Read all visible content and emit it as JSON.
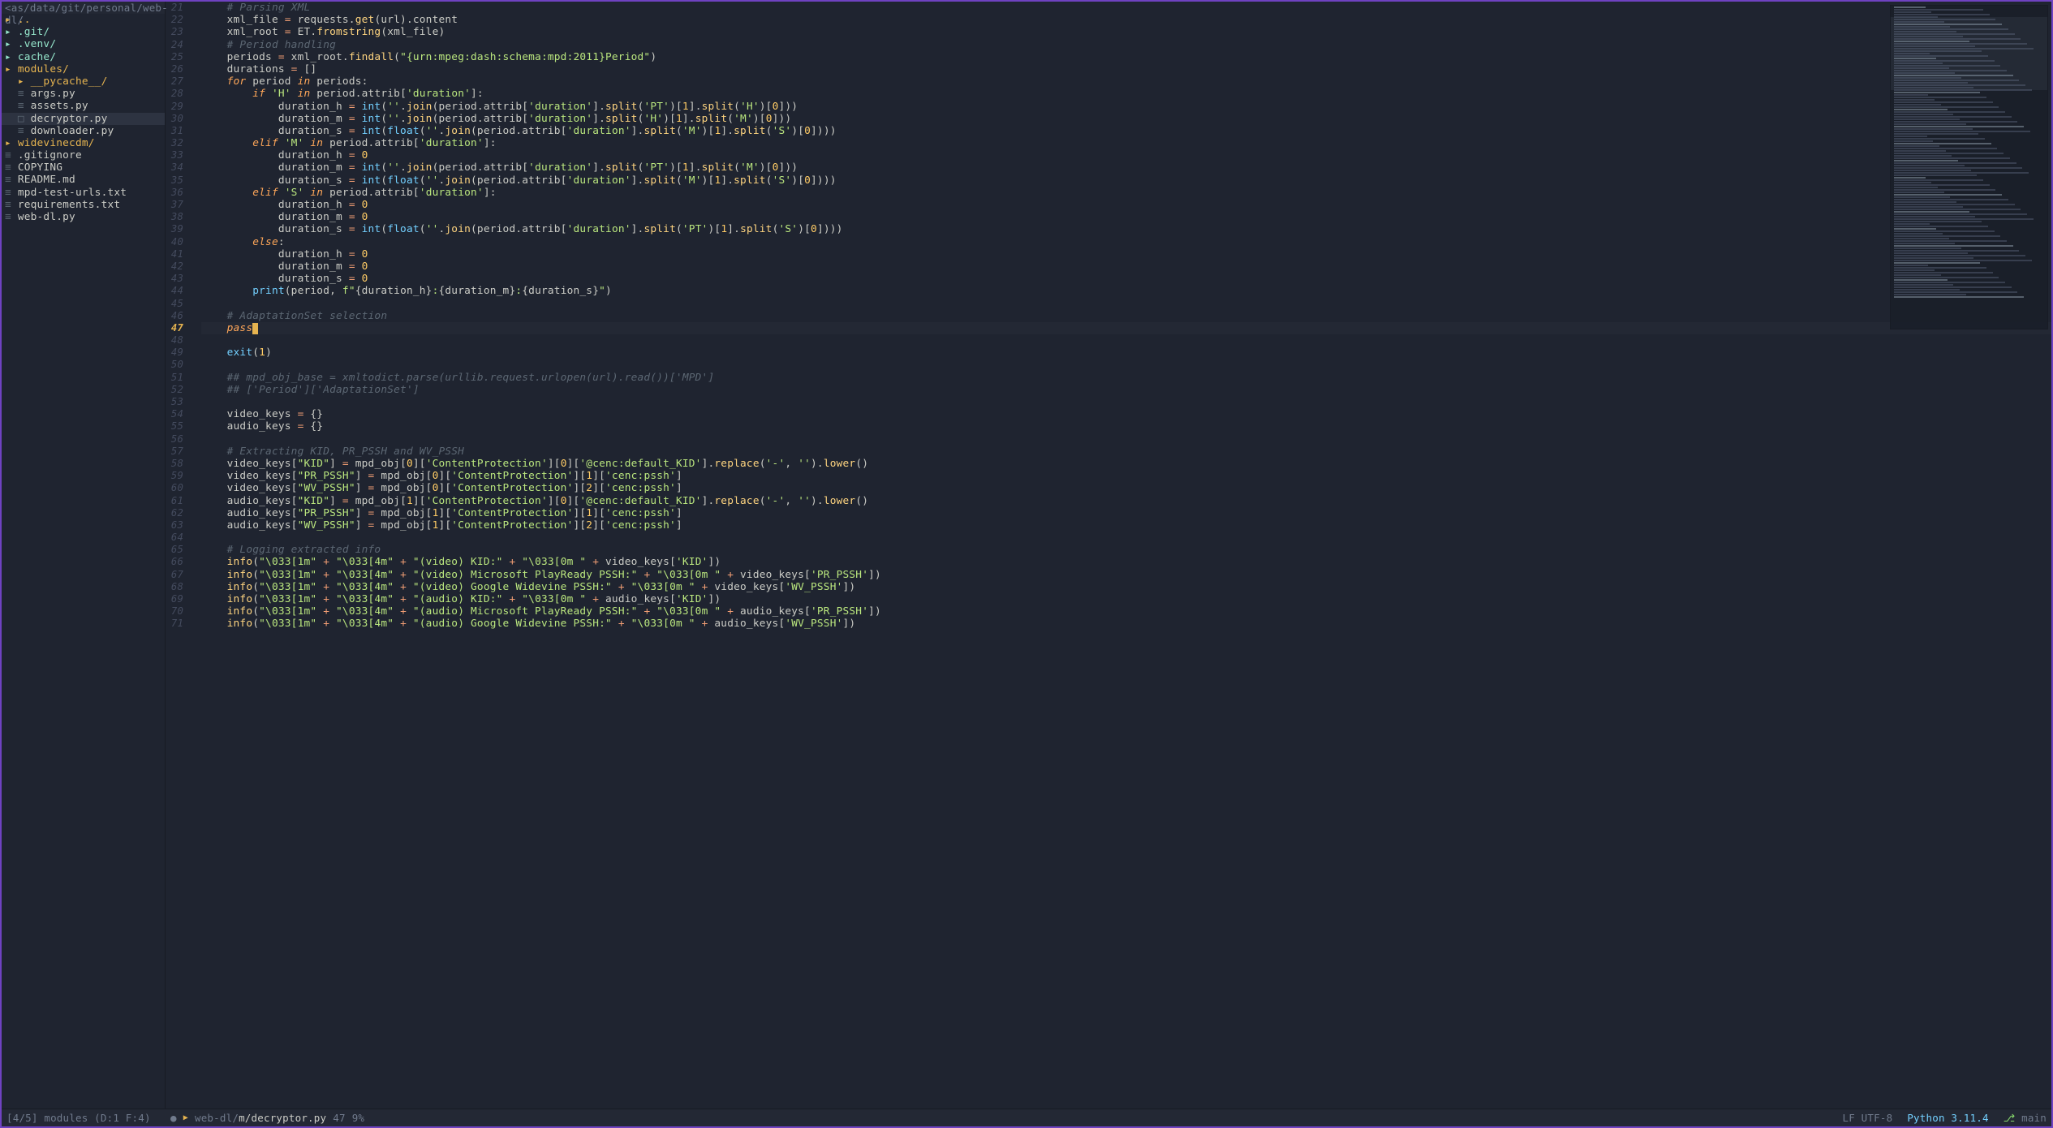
{
  "tree": {
    "header": "<as/data/git/personal/web-dl/",
    "items": [
      {
        "indent": 0,
        "icon": "folder",
        "name": "..",
        "style": "folder"
      },
      {
        "indent": 0,
        "icon": "folderg",
        "name": ".git/",
        "style": "folderg"
      },
      {
        "indent": 0,
        "icon": "folderg",
        "name": ".venv/",
        "style": "folderg"
      },
      {
        "indent": 0,
        "icon": "folderg",
        "name": "cache/",
        "style": "folderg"
      },
      {
        "indent": 0,
        "icon": "folder",
        "name": "modules/",
        "style": "folder"
      },
      {
        "indent": 1,
        "icon": "folder",
        "name": "__pycache__/",
        "style": "folder"
      },
      {
        "indent": 1,
        "icon": "file",
        "name": "args.py",
        "style": "name"
      },
      {
        "indent": 1,
        "icon": "file",
        "name": "assets.py",
        "style": "name"
      },
      {
        "indent": 1,
        "icon": "file-open",
        "name": "decryptor.py",
        "style": "name",
        "selected": true
      },
      {
        "indent": 1,
        "icon": "file",
        "name": "downloader.py",
        "style": "name"
      },
      {
        "indent": 0,
        "icon": "folder",
        "name": "widevinecdm/",
        "style": "folder"
      },
      {
        "indent": 0,
        "icon": "file",
        "name": ".gitignore",
        "style": "name"
      },
      {
        "indent": 0,
        "icon": "file",
        "name": "COPYING",
        "style": "name"
      },
      {
        "indent": 0,
        "icon": "file",
        "name": "README.md",
        "style": "name"
      },
      {
        "indent": 0,
        "icon": "file",
        "name": "mpd-test-urls.txt",
        "style": "name"
      },
      {
        "indent": 0,
        "icon": "file",
        "name": "requirements.txt",
        "style": "name"
      },
      {
        "indent": 0,
        "icon": "file",
        "name": "web-dl.py",
        "style": "name"
      }
    ]
  },
  "editor": {
    "first_line": 21,
    "current_line": 47,
    "lines": [
      {
        "n": 21,
        "html": "    <span class='c-cmt'># Parsing XML</span>"
      },
      {
        "n": 22,
        "html": "    xml_file <span class='c-op'>=</span> requests.<span class='c-fn'>get</span>(url).content"
      },
      {
        "n": 23,
        "html": "    xml_root <span class='c-op'>=</span> ET.<span class='c-fn'>fromstring</span>(xml_file)"
      },
      {
        "n": 24,
        "html": "    <span class='c-cmt'># Period handling</span>"
      },
      {
        "n": 25,
        "html": "    periods <span class='c-op'>=</span> xml_root.<span class='c-fn'>findall</span>(<span class='c-str'>\"{urn:mpeg:dash:schema:mpd:2011}Period\"</span>)"
      },
      {
        "n": 26,
        "html": "    durations <span class='c-op'>=</span> []"
      },
      {
        "n": 27,
        "html": "    <span class='c-kw'>for</span> period <span class='c-kw'>in</span> periods:"
      },
      {
        "n": 28,
        "html": "        <span class='c-kw'>if</span> <span class='c-str'>'H'</span> <span class='c-kw'>in</span> period.attrib[<span class='c-str'>'duration'</span>]:"
      },
      {
        "n": 29,
        "html": "            duration_h <span class='c-op'>=</span> <span class='c-builtin'>int</span>(<span class='c-str'>''</span>.<span class='c-fn'>join</span>(period.attrib[<span class='c-str'>'duration'</span>].<span class='c-fn'>split</span>(<span class='c-str'>'PT'</span>)[<span class='c-num'>1</span>].<span class='c-fn'>split</span>(<span class='c-str'>'H'</span>)[<span class='c-num'>0</span>]))"
      },
      {
        "n": 30,
        "html": "            duration_m <span class='c-op'>=</span> <span class='c-builtin'>int</span>(<span class='c-str'>''</span>.<span class='c-fn'>join</span>(period.attrib[<span class='c-str'>'duration'</span>].<span class='c-fn'>split</span>(<span class='c-str'>'H'</span>)[<span class='c-num'>1</span>].<span class='c-fn'>split</span>(<span class='c-str'>'M'</span>)[<span class='c-num'>0</span>]))"
      },
      {
        "n": 31,
        "html": "            duration_s <span class='c-op'>=</span> <span class='c-builtin'>int</span>(<span class='c-builtin'>float</span>(<span class='c-str'>''</span>.<span class='c-fn'>join</span>(period.attrib[<span class='c-str'>'duration'</span>].<span class='c-fn'>split</span>(<span class='c-str'>'M'</span>)[<span class='c-num'>1</span>].<span class='c-fn'>split</span>(<span class='c-str'>'S'</span>)[<span class='c-num'>0</span>])))"
      },
      {
        "n": 32,
        "html": "        <span class='c-kw'>elif</span> <span class='c-str'>'M'</span> <span class='c-kw'>in</span> period.attrib[<span class='c-str'>'duration'</span>]:"
      },
      {
        "n": 33,
        "html": "            duration_h <span class='c-op'>=</span> <span class='c-num'>0</span>"
      },
      {
        "n": 34,
        "html": "            duration_m <span class='c-op'>=</span> <span class='c-builtin'>int</span>(<span class='c-str'>''</span>.<span class='c-fn'>join</span>(period.attrib[<span class='c-str'>'duration'</span>].<span class='c-fn'>split</span>(<span class='c-str'>'PT'</span>)[<span class='c-num'>1</span>].<span class='c-fn'>split</span>(<span class='c-str'>'M'</span>)[<span class='c-num'>0</span>]))"
      },
      {
        "n": 35,
        "html": "            duration_s <span class='c-op'>=</span> <span class='c-builtin'>int</span>(<span class='c-builtin'>float</span>(<span class='c-str'>''</span>.<span class='c-fn'>join</span>(period.attrib[<span class='c-str'>'duration'</span>].<span class='c-fn'>split</span>(<span class='c-str'>'M'</span>)[<span class='c-num'>1</span>].<span class='c-fn'>split</span>(<span class='c-str'>'S'</span>)[<span class='c-num'>0</span>])))"
      },
      {
        "n": 36,
        "html": "        <span class='c-kw'>elif</span> <span class='c-str'>'S'</span> <span class='c-kw'>in</span> period.attrib[<span class='c-str'>'duration'</span>]:"
      },
      {
        "n": 37,
        "html": "            duration_h <span class='c-op'>=</span> <span class='c-num'>0</span>"
      },
      {
        "n": 38,
        "html": "            duration_m <span class='c-op'>=</span> <span class='c-num'>0</span>"
      },
      {
        "n": 39,
        "html": "            duration_s <span class='c-op'>=</span> <span class='c-builtin'>int</span>(<span class='c-builtin'>float</span>(<span class='c-str'>''</span>.<span class='c-fn'>join</span>(period.attrib[<span class='c-str'>'duration'</span>].<span class='c-fn'>split</span>(<span class='c-str'>'PT'</span>)[<span class='c-num'>1</span>].<span class='c-fn'>split</span>(<span class='c-str'>'S'</span>)[<span class='c-num'>0</span>])))"
      },
      {
        "n": 40,
        "html": "        <span class='c-kw'>else</span>:"
      },
      {
        "n": 41,
        "html": "            duration_h <span class='c-op'>=</span> <span class='c-num'>0</span>"
      },
      {
        "n": 42,
        "html": "            duration_m <span class='c-op'>=</span> <span class='c-num'>0</span>"
      },
      {
        "n": 43,
        "html": "            duration_s <span class='c-op'>=</span> <span class='c-num'>0</span>"
      },
      {
        "n": 44,
        "html": "        <span class='c-builtin'>print</span>(period, <span class='c-str'>f\"</span>{duration_h}<span class='c-str'>:</span>{duration_m}<span class='c-str'>:</span>{duration_s}<span class='c-str'>\"</span>)"
      },
      {
        "n": 45,
        "html": ""
      },
      {
        "n": 46,
        "html": "    <span class='c-cmt'># AdaptationSet selection</span>"
      },
      {
        "n": 47,
        "html": "    <span class='c-kw'>pass</span><span class='cursor-block'></span>",
        "current": true
      },
      {
        "n": 48,
        "html": ""
      },
      {
        "n": 49,
        "html": "    <span class='c-builtin'>exit</span>(<span class='c-num'>1</span>)"
      },
      {
        "n": 50,
        "html": ""
      },
      {
        "n": 51,
        "html": "    <span class='c-cmt'>## mpd_obj_base = xmltodict.parse(urllib.request.urlopen(url).read())['MPD']</span>"
      },
      {
        "n": 52,
        "html": "    <span class='c-cmt'>## ['Period']['AdaptationSet']</span>"
      },
      {
        "n": 53,
        "html": ""
      },
      {
        "n": 54,
        "html": "    video_keys <span class='c-op'>=</span> {}"
      },
      {
        "n": 55,
        "html": "    audio_keys <span class='c-op'>=</span> {}"
      },
      {
        "n": 56,
        "html": ""
      },
      {
        "n": 57,
        "html": "    <span class='c-cmt'># Extracting KID, PR_PSSH and WV_PSSH</span>"
      },
      {
        "n": 58,
        "html": "    video_keys[<span class='c-str'>\"KID\"</span>] <span class='c-op'>=</span> mpd_obj[<span class='c-num'>0</span>][<span class='c-str'>'ContentProtection'</span>][<span class='c-num'>0</span>][<span class='c-str'>'@cenc:default_KID'</span>].<span class='c-fn'>replace</span>(<span class='c-str'>'-'</span>, <span class='c-str'>''</span>).<span class='c-fn'>lower</span>()"
      },
      {
        "n": 59,
        "html": "    video_keys[<span class='c-str'>\"PR_PSSH\"</span>] <span class='c-op'>=</span> mpd_obj[<span class='c-num'>0</span>][<span class='c-str'>'ContentProtection'</span>][<span class='c-num'>1</span>][<span class='c-str'>'cenc:pssh'</span>]"
      },
      {
        "n": 60,
        "html": "    video_keys[<span class='c-str'>\"WV_PSSH\"</span>] <span class='c-op'>=</span> mpd_obj[<span class='c-num'>0</span>][<span class='c-str'>'ContentProtection'</span>][<span class='c-num'>2</span>][<span class='c-str'>'cenc:pssh'</span>]"
      },
      {
        "n": 61,
        "html": "    audio_keys[<span class='c-str'>\"KID\"</span>] <span class='c-op'>=</span> mpd_obj[<span class='c-num'>1</span>][<span class='c-str'>'ContentProtection'</span>][<span class='c-num'>0</span>][<span class='c-str'>'@cenc:default_KID'</span>].<span class='c-fn'>replace</span>(<span class='c-str'>'-'</span>, <span class='c-str'>''</span>).<span class='c-fn'>lower</span>()"
      },
      {
        "n": 62,
        "html": "    audio_keys[<span class='c-str'>\"PR_PSSH\"</span>] <span class='c-op'>=</span> mpd_obj[<span class='c-num'>1</span>][<span class='c-str'>'ContentProtection'</span>][<span class='c-num'>1</span>][<span class='c-str'>'cenc:pssh'</span>]"
      },
      {
        "n": 63,
        "html": "    audio_keys[<span class='c-str'>\"WV_PSSH\"</span>] <span class='c-op'>=</span> mpd_obj[<span class='c-num'>1</span>][<span class='c-str'>'ContentProtection'</span>][<span class='c-num'>2</span>][<span class='c-str'>'cenc:pssh'</span>]"
      },
      {
        "n": 64,
        "html": ""
      },
      {
        "n": 65,
        "html": "    <span class='c-cmt'># Logging extracted info</span>"
      },
      {
        "n": 66,
        "html": "    <span class='c-fn'>info</span>(<span class='c-str'>\"\\033[1m\"</span> <span class='c-op'>+</span> <span class='c-str'>\"\\033[4m\"</span> <span class='c-op'>+</span> <span class='c-str'>\"(video) KID:\"</span> <span class='c-op'>+</span> <span class='c-str'>\"\\033[0m \"</span> <span class='c-op'>+</span> video_keys[<span class='c-str'>'KID'</span>])"
      },
      {
        "n": 67,
        "html": "    <span class='c-fn'>info</span>(<span class='c-str'>\"\\033[1m\"</span> <span class='c-op'>+</span> <span class='c-str'>\"\\033[4m\"</span> <span class='c-op'>+</span> <span class='c-str'>\"(video) Microsoft PlayReady PSSH:\"</span> <span class='c-op'>+</span> <span class='c-str'>\"\\033[0m \"</span> <span class='c-op'>+</span> video_keys[<span class='c-str'>'PR_PSSH'</span>])"
      },
      {
        "n": 68,
        "html": "    <span class='c-fn'>info</span>(<span class='c-str'>\"\\033[1m\"</span> <span class='c-op'>+</span> <span class='c-str'>\"\\033[4m\"</span> <span class='c-op'>+</span> <span class='c-str'>\"(video) Google Widevine PSSH:\"</span> <span class='c-op'>+</span> <span class='c-str'>\"\\033[0m \"</span> <span class='c-op'>+</span> video_keys[<span class='c-str'>'WV_PSSH'</span>])"
      },
      {
        "n": 69,
        "html": "    <span class='c-fn'>info</span>(<span class='c-str'>\"\\033[1m\"</span> <span class='c-op'>+</span> <span class='c-str'>\"\\033[4m\"</span> <span class='c-op'>+</span> <span class='c-str'>\"(audio) KID:\"</span> <span class='c-op'>+</span> <span class='c-str'>\"\\033[0m \"</span> <span class='c-op'>+</span> audio_keys[<span class='c-str'>'KID'</span>])"
      },
      {
        "n": 70,
        "html": "    <span class='c-fn'>info</span>(<span class='c-str'>\"\\033[1m\"</span> <span class='c-op'>+</span> <span class='c-str'>\"\\033[4m\"</span> <span class='c-op'>+</span> <span class='c-str'>\"(audio) Microsoft PlayReady PSSH:\"</span> <span class='c-op'>+</span> <span class='c-str'>\"\\033[0m \"</span> <span class='c-op'>+</span> audio_keys[<span class='c-str'>'PR_PSSH'</span>])"
      },
      {
        "n": 71,
        "html": "    <span class='c-fn'>info</span>(<span class='c-str'>\"\\033[1m\"</span> <span class='c-op'>+</span> <span class='c-str'>\"\\033[4m\"</span> <span class='c-op'>+</span> <span class='c-str'>\"(audio) Google Widevine PSSH:\"</span> <span class='c-op'>+</span> <span class='c-str'>\"\\033[0m \"</span> <span class='c-op'>+</span> audio_keys[<span class='c-str'>'WV_PSSH'</span>])"
      }
    ]
  },
  "statusbar": {
    "left": "[4/5] modules (D:1 F:4)",
    "path_dim1": "web-dl/",
    "path_dim2": "m/",
    "path_file": "decryptor.py",
    "line": "47",
    "percent": "9%",
    "encoding": "LF UTF-8",
    "filetype": "Python 3.11.4",
    "branch_icon": "⎇",
    "branch": "main"
  },
  "icons": {
    "folder": "▸",
    "folder_open": "▾",
    "file": "≡",
    "file_open": "□"
  }
}
